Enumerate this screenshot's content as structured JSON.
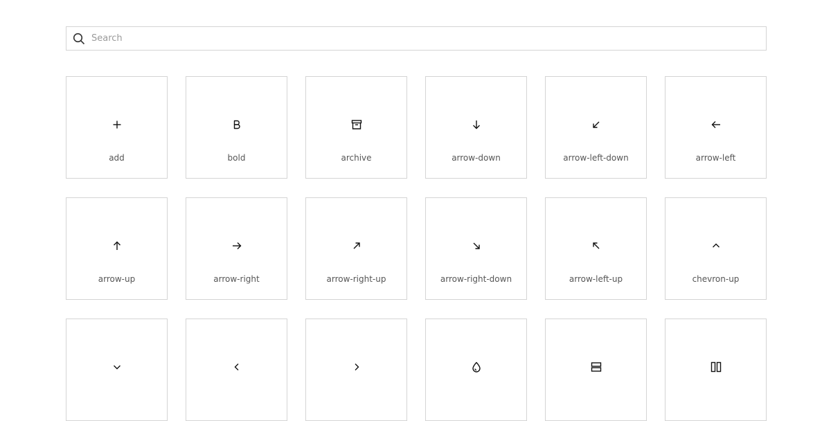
{
  "search": {
    "placeholder": "Search",
    "value": "",
    "icon": "search-icon"
  },
  "icons": [
    {
      "label": "add",
      "icon": "add-icon"
    },
    {
      "label": "bold",
      "icon": "bold-icon"
    },
    {
      "label": "archive",
      "icon": "archive-icon"
    },
    {
      "label": "arrow-down",
      "icon": "arrow-down-icon"
    },
    {
      "label": "arrow-left-down",
      "icon": "arrow-left-down-icon"
    },
    {
      "label": "arrow-left",
      "icon": "arrow-left-icon"
    },
    {
      "label": "arrow-up",
      "icon": "arrow-up-icon"
    },
    {
      "label": "arrow-right",
      "icon": "arrow-right-icon"
    },
    {
      "label": "arrow-right-up",
      "icon": "arrow-right-up-icon"
    },
    {
      "label": "arrow-right-down",
      "icon": "arrow-right-down-icon"
    },
    {
      "label": "arrow-left-up",
      "icon": "arrow-left-up-icon"
    },
    {
      "label": "chevron-up",
      "icon": "chevron-up-icon"
    },
    {
      "label": "",
      "icon": "chevron-down-icon"
    },
    {
      "label": "",
      "icon": "chevron-left-icon"
    },
    {
      "label": "",
      "icon": "chevron-right-icon"
    },
    {
      "label": "",
      "icon": "drop-icon"
    },
    {
      "label": "",
      "icon": "split-horizontal-icon"
    },
    {
      "label": "",
      "icon": "split-vertical-icon"
    }
  ]
}
